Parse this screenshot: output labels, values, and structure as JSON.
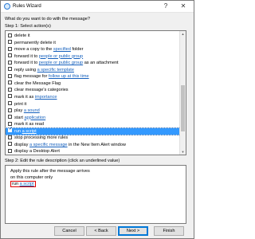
{
  "window": {
    "title": "Rules Wizard",
    "help_label": "?",
    "close_label": "✕"
  },
  "prompt": "What do you want to do with the message?",
  "step1_label": "Step 1: Select action(s)",
  "actions": [
    {
      "pre": "delete it",
      "link": "",
      "post": "",
      "checked": false,
      "selected": false
    },
    {
      "pre": "permanently delete it",
      "link": "",
      "post": "",
      "checked": false,
      "selected": false
    },
    {
      "pre": "move a copy to the ",
      "link": "specified",
      "post": " folder",
      "checked": false,
      "selected": false
    },
    {
      "pre": "forward it to ",
      "link": "people or public group",
      "post": "",
      "checked": false,
      "selected": false
    },
    {
      "pre": "forward it to ",
      "link": "people or public group",
      "post": " as an attachment",
      "checked": false,
      "selected": false
    },
    {
      "pre": "reply using ",
      "link": "a specific template",
      "post": "",
      "checked": false,
      "selected": false
    },
    {
      "pre": "flag message for ",
      "link": "follow up at this time",
      "post": "",
      "checked": false,
      "selected": false
    },
    {
      "pre": "clear the Message Flag",
      "link": "",
      "post": "",
      "checked": false,
      "selected": false
    },
    {
      "pre": "clear message's categories",
      "link": "",
      "post": "",
      "checked": false,
      "selected": false
    },
    {
      "pre": "mark it as ",
      "link": "importance",
      "post": "",
      "checked": false,
      "selected": false
    },
    {
      "pre": "print it",
      "link": "",
      "post": "",
      "checked": false,
      "selected": false
    },
    {
      "pre": "play ",
      "link": "a sound",
      "post": "",
      "checked": false,
      "selected": false
    },
    {
      "pre": "start ",
      "link": "application",
      "post": "",
      "checked": false,
      "selected": false
    },
    {
      "pre": "mark it as read",
      "link": "",
      "post": "",
      "checked": false,
      "selected": false
    },
    {
      "pre": "run ",
      "link": "a script",
      "post": "",
      "checked": true,
      "selected": true
    },
    {
      "pre": "stop processing more rules",
      "link": "",
      "post": "",
      "checked": false,
      "selected": false
    },
    {
      "pre": "display ",
      "link": "a specific message",
      "post": " in the New Item Alert window",
      "checked": false,
      "selected": false
    },
    {
      "pre": "display a Desktop Alert",
      "link": "",
      "post": "",
      "checked": false,
      "selected": false
    }
  ],
  "step2_label": "Step 2: Edit the rule description (click an underlined value)",
  "description": {
    "line1": "Apply this rule after the message arrives",
    "line2": "on this computer only",
    "line3_pre": "run ",
    "line3_link": "a script"
  },
  "buttons": {
    "cancel": "Cancel",
    "back": "< Back",
    "next": "Next >",
    "finish": "Finish"
  },
  "colors": {
    "selection": "#3399ff",
    "link": "#1560bd",
    "highlight_box": "#e00000"
  }
}
